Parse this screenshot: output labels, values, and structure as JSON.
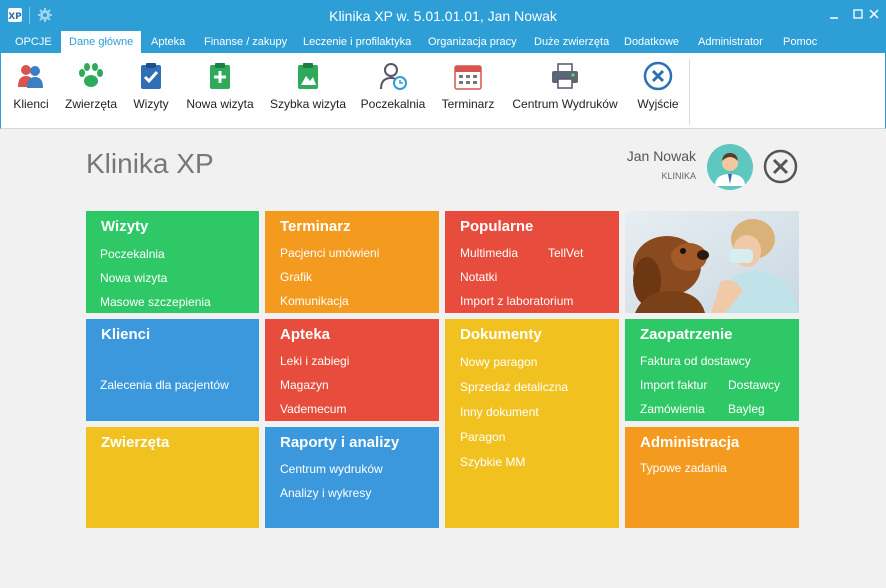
{
  "window": {
    "title": "Klinika XP w. 5.01.01.01, Jan Nowak"
  },
  "menu": {
    "tabs": [
      {
        "label": "OPCJE"
      },
      {
        "label": "Dane główne"
      },
      {
        "label": "Apteka"
      },
      {
        "label": "Finanse / zakupy"
      },
      {
        "label": "Leczenie i profilaktyka"
      },
      {
        "label": "Organizacja pracy"
      },
      {
        "label": "Duże zwierzęta"
      },
      {
        "label": "Dodatkowe"
      },
      {
        "label": "Administrator"
      },
      {
        "label": "Pomoc"
      }
    ],
    "active_tab": "Dane główne"
  },
  "ribbon": {
    "buttons": [
      {
        "label": "Klienci",
        "icon": "clients-icon"
      },
      {
        "label": "Zwierzęta",
        "icon": "paw-icon"
      },
      {
        "label": "Wizyty",
        "icon": "clipboard-check-icon"
      },
      {
        "label": "Nowa wizyta",
        "icon": "clipboard-plus-icon"
      },
      {
        "label": "Szybka wizyta",
        "icon": "clipboard-image-icon"
      },
      {
        "label": "Poczekalnia",
        "icon": "user-clock-icon"
      },
      {
        "label": "Terminarz",
        "icon": "calendar-icon"
      },
      {
        "label": "Centrum Wydruków",
        "icon": "printer-icon"
      },
      {
        "label": "Wyjście",
        "icon": "exit-icon"
      }
    ]
  },
  "header": {
    "app_title": "Klinika XP",
    "user_name": "Jan Nowak",
    "user_role": "KLINIKA"
  },
  "tiles": {
    "wizyty": {
      "title": "Wizyty",
      "links": [
        "Poczekalnia",
        "Nowa wizyta",
        "Masowe szczepienia"
      ],
      "color": "#2ec866"
    },
    "terminarz": {
      "title": "Terminarz",
      "links": [
        "Pacjenci umówieni",
        "Grafik",
        "Komunikacja"
      ],
      "color": "#f49a1f"
    },
    "popularne": {
      "title": "Popularne",
      "links": [
        "Multimedia",
        "TellVet",
        "Notatki",
        "Import z laboratorium"
      ],
      "color": "#e74c3c"
    },
    "klienci": {
      "title": "Klienci",
      "links": [
        "Zalecenia dla pacjentów"
      ],
      "color": "#3b98dd"
    },
    "apteka": {
      "title": "Apteka",
      "links": [
        "Leki i zabiegi",
        "Magazyn",
        "Vademecum"
      ],
      "color": "#e74c3c"
    },
    "dokumenty": {
      "title": "Dokumenty",
      "links": [
        "Nowy paragon",
        "Sprzedaż detaliczna",
        "Inny dokument",
        "Paragon",
        "Szybkie MM"
      ],
      "color": "#f1c21f"
    },
    "zaopatrzenie": {
      "title": "Zaopatrzenie",
      "links": [
        "Faktura od dostawcy",
        "Import faktur",
        "Dostawcy",
        "Zamówienia",
        "Bayleg"
      ],
      "color": "#2ec866"
    },
    "zwierzeta": {
      "title": "Zwierzęta",
      "links": [],
      "color": "#f1c21f"
    },
    "raporty": {
      "title": "Raporty i analizy",
      "links": [
        "Centrum wydruków",
        "Analizy i wykresy"
      ],
      "color": "#3b98dd"
    },
    "administracja": {
      "title": "Administracja",
      "links": [
        "Typowe zadania"
      ],
      "color": "#f49a1f"
    }
  },
  "colors": {
    "accent": "#2d9fd6",
    "background": "#f1f1f1"
  }
}
